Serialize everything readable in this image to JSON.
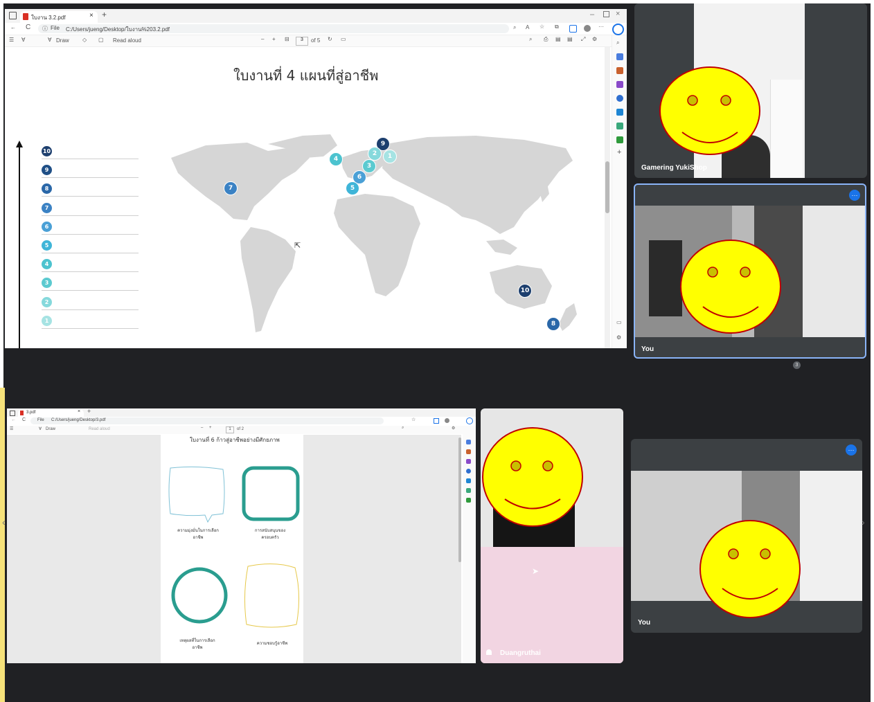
{
  "top_browser": {
    "tab_title": "ใบงาน 3.2.pdf",
    "address_prefix": "File",
    "address": "C:/Users/jueng/Desktop/ใบงาน%203.2.pdf",
    "draw_label": "Draw",
    "read_aloud_label": "Read aloud",
    "page_current": "3",
    "page_total": "of 5"
  },
  "slide": {
    "title": "ใบงานที่ 4 แผนที่สู่อาชีพ",
    "scale_numbers": [
      "10",
      "9",
      "8",
      "7",
      "6",
      "5",
      "4",
      "3",
      "2",
      "1"
    ],
    "scale_colors": [
      "#1d3f6e",
      "#1f4f86",
      "#2a67a8",
      "#3b82c4",
      "#4aa0d6",
      "#3fb5d8",
      "#4cc3cf",
      "#5ccad0",
      "#86d9dc",
      "#a6e3e3"
    ],
    "pins": [
      {
        "label": "9",
        "color": "#1d3f6e"
      },
      {
        "label": "2",
        "color": "#86d9dc"
      },
      {
        "label": "1",
        "color": "#a6e3e3"
      },
      {
        "label": "4",
        "color": "#4cc3cf"
      },
      {
        "label": "3",
        "color": "#5ccad0"
      },
      {
        "label": "6",
        "color": "#4aa0d6"
      },
      {
        "label": "5",
        "color": "#3fb5d8"
      },
      {
        "label": "7",
        "color": "#3b82c4"
      },
      {
        "label": "10",
        "color": "#1d3f6e"
      },
      {
        "label": "8",
        "color": "#2a67a8"
      }
    ]
  },
  "bottom_browser": {
    "tab_title": "3.pdf",
    "address_prefix": "File",
    "address": "C:/Users/jueng/Desktop/3.pdf",
    "draw_label": "Draw",
    "read_aloud_label": "Read aloud",
    "page_current": "1",
    "page_total": "of 2"
  },
  "worksheet": {
    "title": "ใบงานที่ 6 ก้าวสู่อาชีพอย่างมีศักยภาพ",
    "labels": [
      "ความมุ่งมั่นในการเลือกอาชีพ",
      "การสนับสนุนของครอบครัว",
      "เหตุผลที่ในการเลือกอาชีพ",
      "ความชอบรู้อาชีพ"
    ]
  },
  "participants": {
    "top_right_name": "Gamering YukiShop",
    "you_top_name": "You",
    "center_name": "Duangruthai",
    "you_bottom_name": "You",
    "more_icon": "more-options-icon",
    "page_dot": "3"
  },
  "colors": {
    "meet_bg": "#202124",
    "tile_bg": "#3c4043",
    "accent_blue": "#1a73e8",
    "smiley_fill": "#ffff00",
    "smiley_outline": "#c00000"
  }
}
